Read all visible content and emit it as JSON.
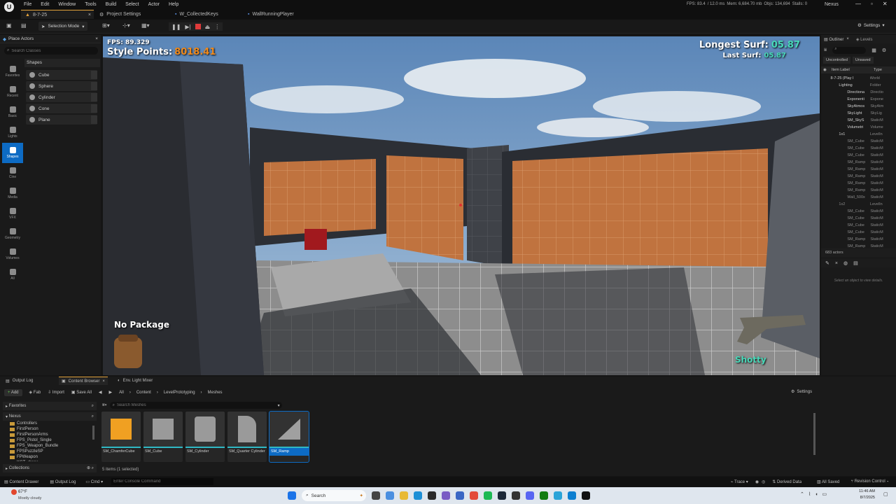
{
  "titlebar": {
    "logo": "U",
    "menu": [
      "File",
      "Edit",
      "Window",
      "Tools",
      "Build",
      "Select",
      "Actor",
      "Help"
    ],
    "project_tab": "8-7-25",
    "tabs": [
      "Project Settings",
      "W_CollectedKeys",
      "WallRunningPlayer"
    ],
    "stats": {
      "fps": "FPS: 83.4",
      "ms": "/ 12.0 ms",
      "mem": "Mem: 6,684.70 mb",
      "objs": "Objs: 134,694",
      "stalls": "Stalls: 0"
    },
    "project_name": "Nexus"
  },
  "toolbar": {
    "selection_mode": "Selection Mode",
    "settings": "Settings"
  },
  "place_actors": {
    "tab": "Place Actors",
    "search_placeholder": "Search Classes",
    "section": "Shapes",
    "categories": [
      "Favorites",
      "Recent",
      "Basic",
      "Lights",
      "Shapes",
      "Cine",
      "Media",
      "VFX",
      "Geometry",
      "Volumes",
      "All"
    ],
    "shapes": [
      "Cube",
      "Sphere",
      "Cylinder",
      "Cone",
      "Plane"
    ]
  },
  "viewport": {
    "fps": "FPS: 89.329",
    "style_label": "Style Points:",
    "style_value": "8018.41",
    "longest_label": "Longest Surf:",
    "longest_value": "05.87",
    "last_label": "Last Surf:",
    "last_value": "05.87",
    "package": "No Package",
    "weapon": "Shotty"
  },
  "outliner": {
    "tabs": [
      "Outliner",
      "Levels"
    ],
    "filters": [
      "Uncontrolled",
      "Unsaved"
    ],
    "col_label": "Item Label",
    "col_type": "Type",
    "rows": [
      {
        "label": "8-7-25 (Play I",
        "type": "World"
      },
      {
        "label": "Lighting",
        "type": "Folder"
      },
      {
        "label": "Directiona",
        "type": "Directio"
      },
      {
        "label": "Exponenti",
        "type": "Expone"
      },
      {
        "label": "SkyAtmos",
        "type": "SkyAtm"
      },
      {
        "label": "SkyLight",
        "type": "SkyLig"
      },
      {
        "label": "SM_SkyS",
        "type": "StaticM"
      },
      {
        "label": "Volumetri",
        "type": "Volume"
      },
      {
        "label": "1x1",
        "type": "LevelIn"
      },
      {
        "label": "SM_Cube",
        "type": "StaticM"
      },
      {
        "label": "SM_Cube",
        "type": "StaticM"
      },
      {
        "label": "SM_Cube",
        "type": "StaticM"
      },
      {
        "label": "SM_Ramp",
        "type": "StaticM"
      },
      {
        "label": "SM_Ramp",
        "type": "StaticM"
      },
      {
        "label": "SM_Ramp",
        "type": "StaticM"
      },
      {
        "label": "SM_Ramp",
        "type": "StaticM"
      },
      {
        "label": "SM_Ramp",
        "type": "StaticM"
      },
      {
        "label": "Wall_500x",
        "type": "StaticM"
      },
      {
        "label": "1x2",
        "type": "LevelIn"
      },
      {
        "label": "SM_Cube",
        "type": "StaticM"
      },
      {
        "label": "SM_Cube",
        "type": "StaticM"
      },
      {
        "label": "SM_Cube",
        "type": "StaticM"
      },
      {
        "label": "SM_Cube",
        "type": "StaticM"
      },
      {
        "label": "SM_Ramp",
        "type": "StaticM"
      },
      {
        "label": "SM_Ramp",
        "type": "StaticM"
      }
    ],
    "count": "683 actors",
    "details_hint": "Select an object to view details."
  },
  "bottom": {
    "tabs": [
      "Output Log",
      "Content Browser",
      "Env. Light Mixer"
    ],
    "add": "Add",
    "fab": "Fab",
    "import": "Import",
    "save_all": "Save All",
    "path": [
      "All",
      "Content",
      "LevelPrototyping",
      "Meshes"
    ],
    "settings": "Settings",
    "favorites": "Favorites",
    "root": "Nexus",
    "folders": [
      "Controllers",
      "FirstPerson",
      "FirstPersonArms",
      "FPS_Pistol_Single",
      "FPS_Weapon_Bundle",
      "FPSPuzzleSP",
      "FPWeapon",
      "KGT_drone"
    ],
    "collections": "Collections",
    "search_placeholder": "Search Meshes",
    "assets": [
      "SM_ChamferCube",
      "SM_Cube",
      "SM_Cylinder",
      "SM_Quarter Cylinder",
      "SM_Ramp"
    ],
    "items_status": "5 items (1 selected)"
  },
  "statusbar": {
    "content_drawer": "Content Drawer",
    "output_log": "Output Log",
    "cmd": "Cmd",
    "console_placeholder": "Enter Console Command",
    "trace": "Trace",
    "derived": "Derived Data",
    "all_saved": "All Saved",
    "revision": "Revision Control"
  },
  "taskbar": {
    "weather_temp": "67°F",
    "weather_desc": "Mostly cloudy",
    "search": "Search",
    "time": "11:46 AM",
    "date": "8/7/2025"
  }
}
